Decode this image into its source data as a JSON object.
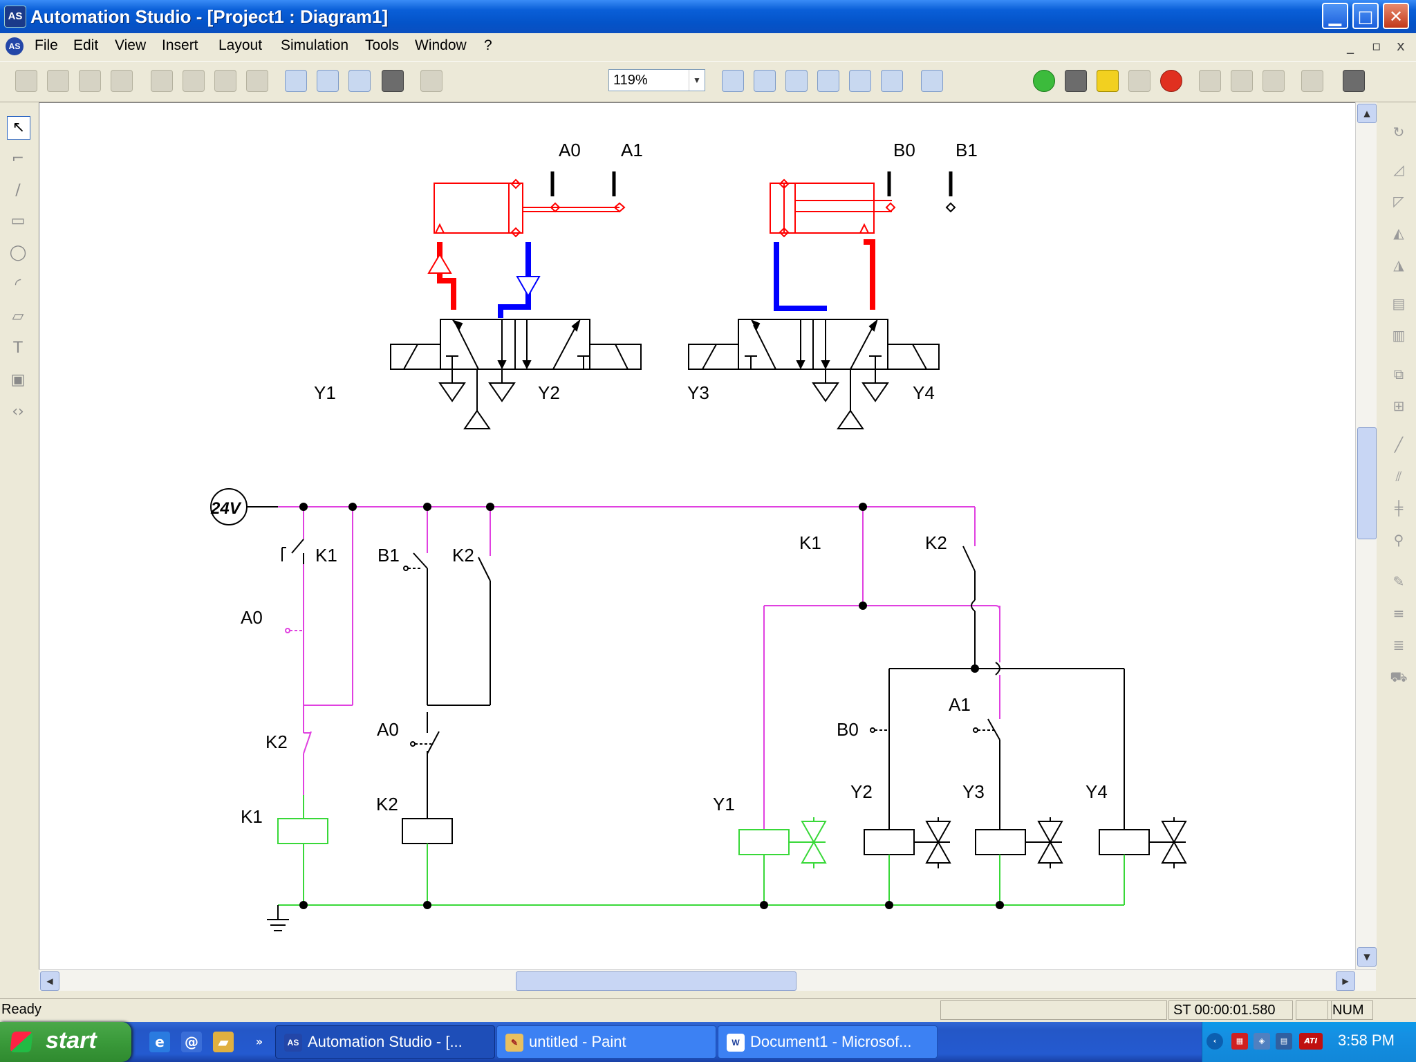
{
  "window": {
    "title": "Automation Studio - [Project1 : Diagram1]",
    "app_icon": "AS",
    "minimize": "▁",
    "maximize": "□",
    "close": "✕"
  },
  "menu": {
    "items": [
      "File",
      "Edit",
      "View",
      "Insert",
      "Layout",
      "Simulation",
      "Tools",
      "Window",
      "?"
    ],
    "mdi_minimize": "_",
    "mdi_restore": "▫",
    "mdi_close": "x"
  },
  "toolbar": {
    "zoom_value": "119%"
  },
  "diagram": {
    "pneumatic_labels": {
      "a0": "A0",
      "a1": "A1",
      "b0": "B0",
      "b1": "B1",
      "y1": "Y1",
      "y2": "Y2",
      "y3": "Y3",
      "y4": "Y4"
    },
    "supply": "24V",
    "ladder_labels": {
      "k1_contact": "K1",
      "k1_hold": "K1",
      "a0_left": "A0",
      "b1": "B1",
      "k2_contact": "K2",
      "k2_nc": "K2",
      "a0_mid": "A0",
      "k1_coil": "K1",
      "k2_coil": "K2",
      "k1_right": "K1",
      "k2_right": "K2",
      "a1": "A1",
      "b0": "B0",
      "y1": "Y1",
      "y2": "Y2",
      "y3": "Y3",
      "y4": "Y4"
    },
    "colors": {
      "active_power": "#e040e0",
      "ground_active": "#38d838",
      "pressure": "#ff0000",
      "exhaust": "#0000ff",
      "wire": "#000000"
    }
  },
  "status": {
    "ready": "Ready",
    "sim_time": "ST 00:00:01.580",
    "num": "NUM"
  },
  "taskbar": {
    "start": "start",
    "tasks": [
      {
        "label": "Automation Studio - [...",
        "icon": "AS"
      },
      {
        "label": "untitled - Paint",
        "icon": "paint"
      },
      {
        "label": "Document1 - Microsof...",
        "icon": "W"
      }
    ],
    "clock": "3:58 PM",
    "tray_ati": "ATI"
  }
}
